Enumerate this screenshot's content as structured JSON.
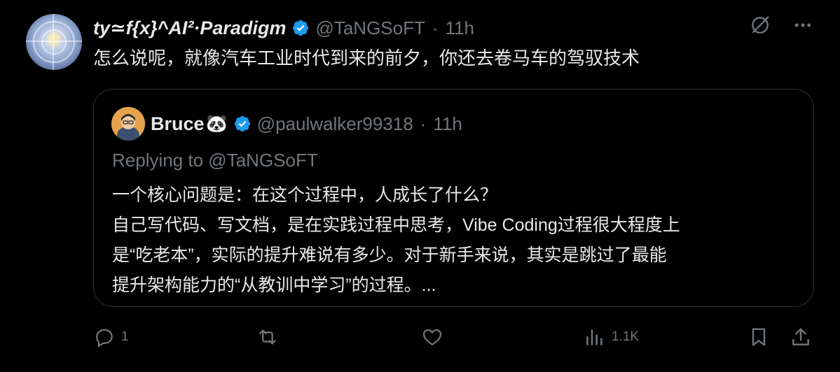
{
  "author": {
    "display_name": "ty≃f{x}^AI²·Paradigm",
    "handle": "@TaNGSoFT",
    "time": "11h",
    "verified": true
  },
  "tweet": {
    "text": "怎么说呢，就像汽车工业时代到来的前夕，你还去卷马车的驾驭技术"
  },
  "quote": {
    "display_name": "Bruce",
    "name_emoji": "🐼",
    "handle": "@paulwalker99318",
    "time": "11h",
    "replying_to": "Replying to @TaNGSoFT",
    "lines": [
      "一个核心问题是：在这个过程中，人成长了什么？",
      "自己写代码、写文档，是在实践过程中思考，Vibe Coding过程很大程度上",
      "是“吃老本”，实际的提升难说有多少。对于新手来说，其实是跳过了最能",
      "提升架构能力的“从教训中学习”的过程。..."
    ]
  },
  "actions": {
    "reply_count": "1",
    "retweet_count": "",
    "like_count": "",
    "views_count": "1.1K"
  },
  "colors": {
    "background": "#000000",
    "text": "#e7e9ea",
    "muted": "#71767b",
    "verified": "#1d9bf0",
    "border": "#2f3336"
  },
  "icons": [
    "verified-badge-icon",
    "grok-icon",
    "more-icon",
    "reply-icon",
    "retweet-icon",
    "like-icon",
    "views-icon",
    "bookmark-icon",
    "share-icon"
  ]
}
